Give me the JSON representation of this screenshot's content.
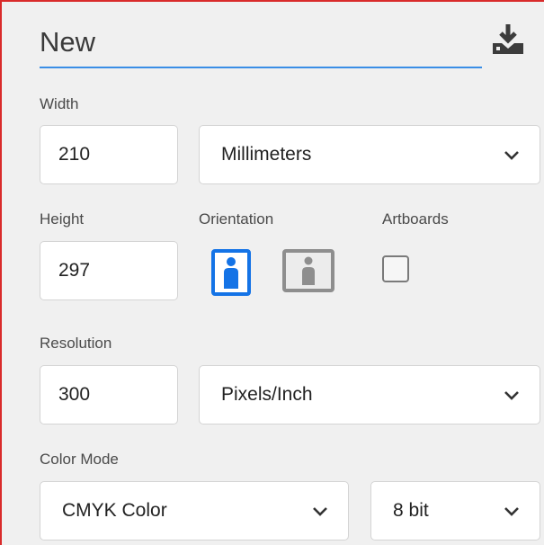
{
  "document": {
    "name": "New"
  },
  "width": {
    "label": "Width",
    "value": "210",
    "unit": "Millimeters"
  },
  "height": {
    "label": "Height",
    "value": "297"
  },
  "orientation": {
    "label": "Orientation",
    "selected": "portrait",
    "options": [
      "portrait",
      "landscape"
    ]
  },
  "artboards": {
    "label": "Artboards",
    "checked": false
  },
  "resolution": {
    "label": "Resolution",
    "value": "300",
    "unit": "Pixels/Inch"
  },
  "color_mode": {
    "label": "Color Mode",
    "mode": "CMYK Color",
    "bit_depth": "8 bit"
  },
  "colors": {
    "accent": "#1473e6",
    "underline": "#3a8ee6",
    "inactive_icon": "#8e8e8e",
    "border": "#d92b2b"
  },
  "icons": {
    "save_preset": "save-preset-icon",
    "chevron": "chevron-down-icon",
    "portrait": "portrait-orientation-icon",
    "landscape": "landscape-orientation-icon"
  }
}
